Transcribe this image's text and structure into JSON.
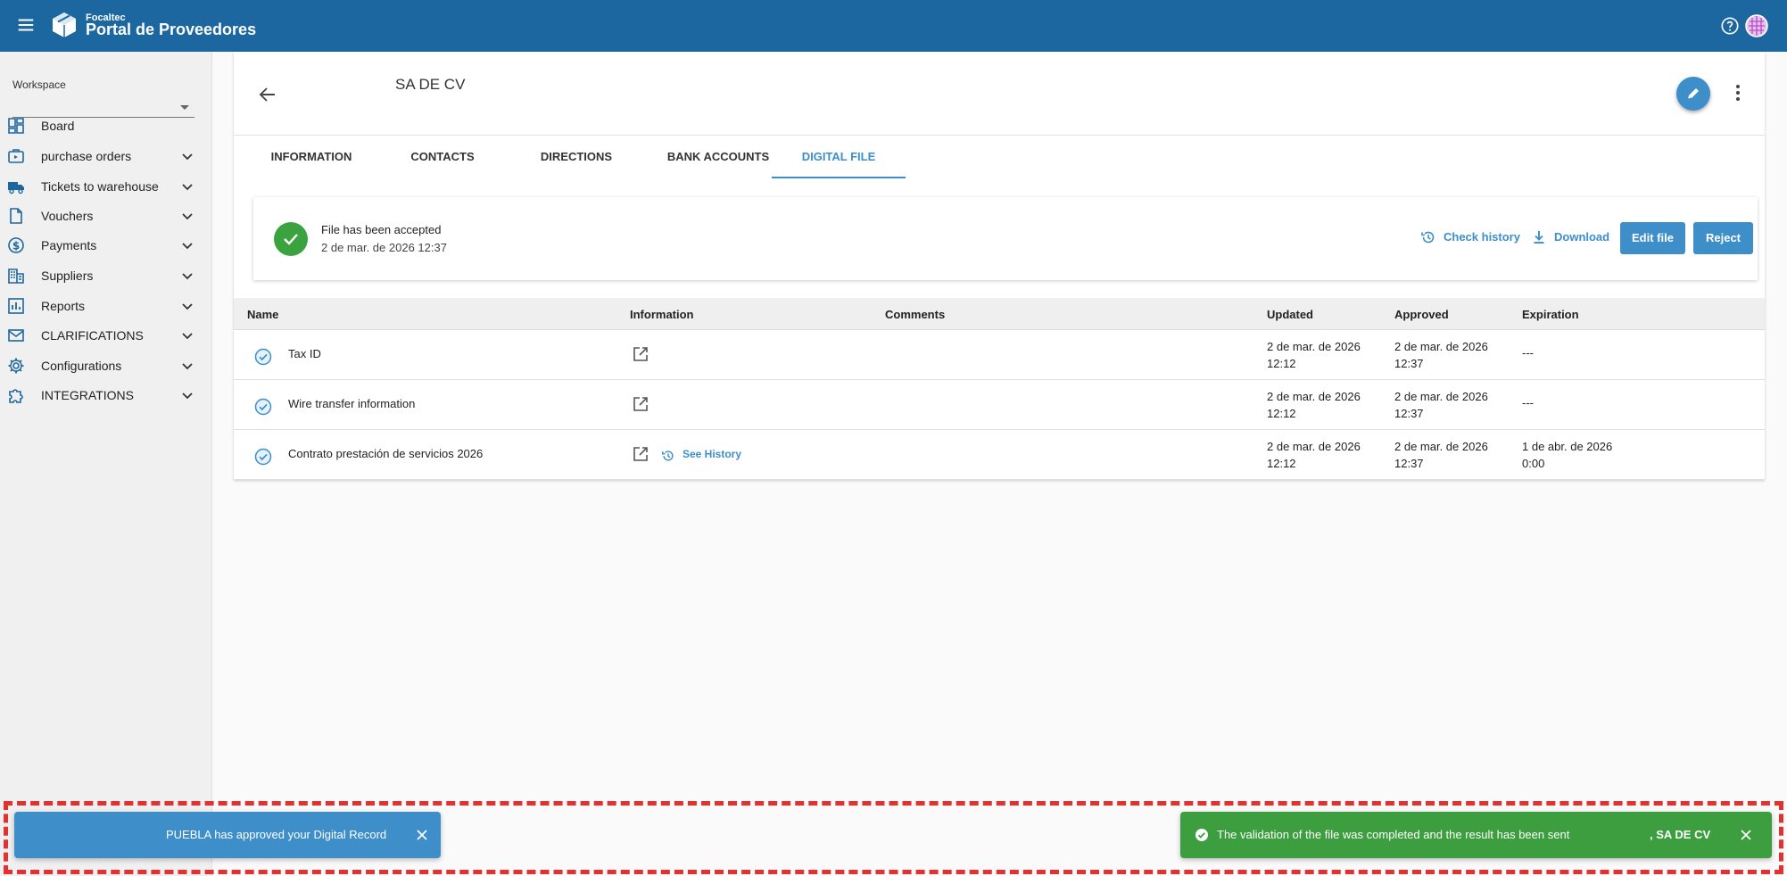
{
  "topbar": {
    "brand_small": "Focaltec",
    "brand_big": "Portal de Proveedores",
    "icons": [
      "menu-icon",
      "cube-logo-icon",
      "help-icon",
      "avatar-icon"
    ]
  },
  "sidebar": {
    "workspace_label": "Workspace",
    "workspace_value": "",
    "items": [
      {
        "label": "Board",
        "icon": "dashboard-icon",
        "expandable": false
      },
      {
        "label": "purchase orders",
        "icon": "briefcase-icon",
        "expandable": true
      },
      {
        "label": "Tickets to warehouse",
        "icon": "truck-icon",
        "expandable": true
      },
      {
        "label": "Vouchers",
        "icon": "document-icon",
        "expandable": true
      },
      {
        "label": "Payments",
        "icon": "dollar-icon",
        "expandable": true
      },
      {
        "label": "Suppliers",
        "icon": "building-icon",
        "expandable": true
      },
      {
        "label": "Reports",
        "icon": "chart-icon",
        "expandable": true
      },
      {
        "label": "CLARIFICATIONS",
        "icon": "mail-icon",
        "expandable": true
      },
      {
        "label": "Configurations",
        "icon": "gear-icon",
        "expandable": true
      },
      {
        "label": "INTEGRATIONS",
        "icon": "puzzle-icon",
        "expandable": true
      }
    ]
  },
  "supplier": {
    "title": "SA DE CV"
  },
  "tabs": [
    {
      "label": "INFORMATION",
      "active": false
    },
    {
      "label": "CONTACTS",
      "active": false
    },
    {
      "label": "DIRECTIONS",
      "active": false
    },
    {
      "label": "BANK ACCOUNTS",
      "active": false
    },
    {
      "label": "DIGITAL FILE",
      "active": true
    }
  ],
  "status": {
    "title": "File has been accepted",
    "date": "2 de mar. de 2026 12:37",
    "check_history": "Check history",
    "download": "Download",
    "edit_file": "Edit file",
    "reject": "Reject"
  },
  "table": {
    "headers": {
      "name": "Name",
      "information": "Information",
      "comments": "Comments",
      "updated": "Updated",
      "approved": "Approved",
      "expiration": "Expiration"
    },
    "rows": [
      {
        "name": "Tax ID",
        "comments": "",
        "updated": "2 de mar. de 2026 12:12",
        "approved": "2 de mar. de 2026 12:37",
        "expiration": "---",
        "history": ""
      },
      {
        "name": "Wire transfer information",
        "comments": "",
        "updated": "2 de mar. de 2026 12:12",
        "approved": "2 de mar. de 2026 12:37",
        "expiration": "---",
        "history": ""
      },
      {
        "name": "Contrato prestación de servicios 2026",
        "comments": "",
        "updated": "2 de mar. de 2026 12:12",
        "approved": "2 de mar. de 2026 12:37",
        "expiration": "1 de abr. de 2026 0:00",
        "history": "See History"
      }
    ]
  },
  "snackbars": {
    "left": "PUEBLA has approved your Digital Record",
    "right": "The validation of the file was completed and the result has been sent",
    "right_suffix": ", SA DE CV"
  },
  "colors": {
    "topbar": "#1c679f",
    "accent": "#3d8ec9",
    "success": "#3aa23e",
    "snackbar_success": "#3d9e40",
    "highlight_border": "#e2312f"
  }
}
